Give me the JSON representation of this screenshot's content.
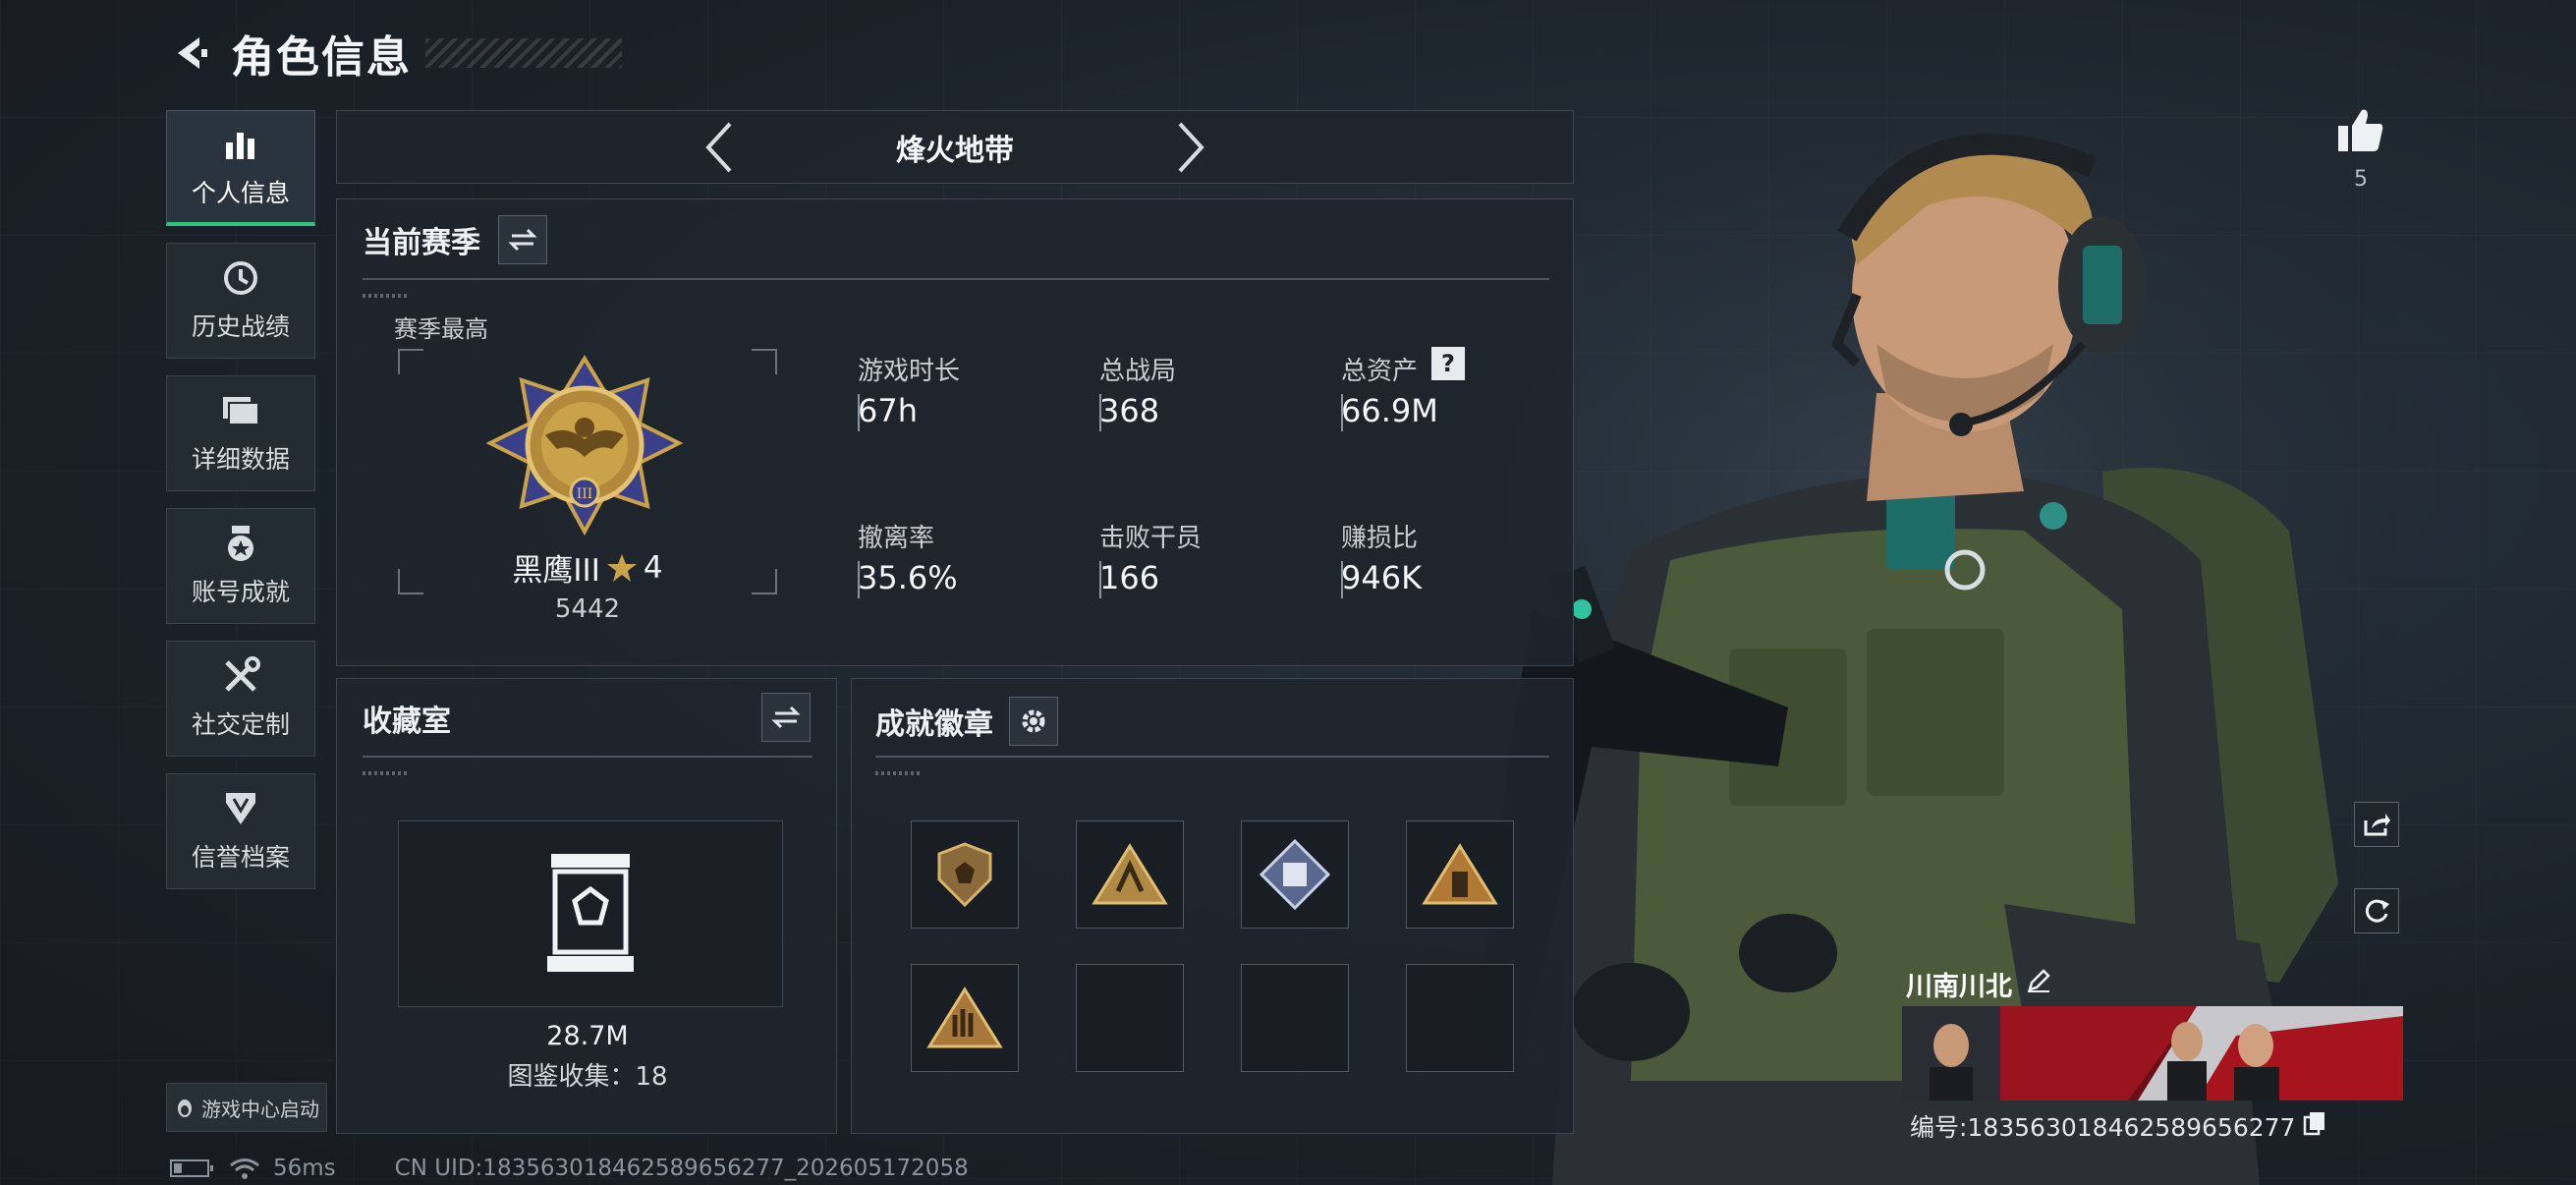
{
  "header": {
    "title": "角色信息",
    "back_icon": "back-arrow-icon"
  },
  "sidebar": {
    "items": [
      {
        "label": "个人信息",
        "icon": "bar-chart-icon",
        "active": true
      },
      {
        "label": "历史战绩",
        "icon": "history-icon",
        "active": false
      },
      {
        "label": "详细数据",
        "icon": "folder-icon",
        "active": false
      },
      {
        "label": "账号成就",
        "icon": "achievement-icon",
        "active": false
      },
      {
        "label": "社交定制",
        "icon": "tools-icon",
        "active": false
      },
      {
        "label": "信誉档案",
        "icon": "shield-icon",
        "active": false
      }
    ],
    "game_center": "游戏中心启动"
  },
  "mode": {
    "name": "烽火地带"
  },
  "season": {
    "title": "当前赛季",
    "best_label": "赛季最高",
    "rank_name": "黑鹰III",
    "rank_stars": "4",
    "rank_score": "5442",
    "stats": [
      {
        "label": "游戏时长",
        "value": "67h"
      },
      {
        "label": "总战局",
        "value": "368"
      },
      {
        "label": "总资产",
        "value": "66.9M"
      },
      {
        "label": "撤离率",
        "value": "35.6%"
      },
      {
        "label": "击败干员",
        "value": "166"
      },
      {
        "label": "赚损比",
        "value": "946K"
      }
    ],
    "help_mark": "?"
  },
  "collection": {
    "title": "收藏室",
    "value": "28.7M",
    "count_text": "图鉴收集：18"
  },
  "achievements": {
    "title": "成就徽章",
    "badges_filled": 5,
    "slots": 8
  },
  "profile": {
    "likes": "5",
    "name": "川南川北",
    "id_text": "编号:183563018462589656277"
  },
  "status": {
    "ping": "56ms",
    "uid": "CN UID:183563018462589656277_202605172058"
  },
  "colors": {
    "accent_green": "#2ec47c",
    "gold": "#c9a24a"
  }
}
